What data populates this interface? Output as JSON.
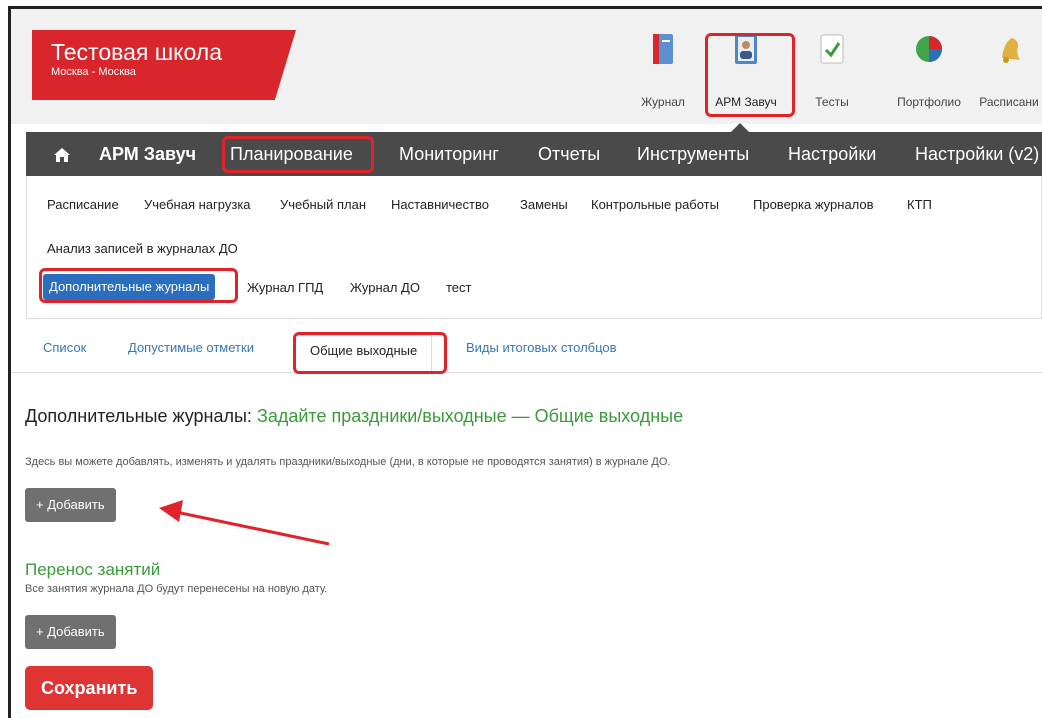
{
  "school": {
    "name": "Тестовая школа",
    "city": "Москва - Москва"
  },
  "apps": [
    {
      "label": "Журнал",
      "icon": "journal-icon"
    },
    {
      "label": "АРМ Завуч",
      "icon": "deputy-icon",
      "highlighted": true
    },
    {
      "label": "Тесты",
      "icon": "tests-icon"
    },
    {
      "label": "Портфолио",
      "icon": "portfolio-icon"
    },
    {
      "label": "Расписани",
      "icon": "bell-icon"
    }
  ],
  "topnav": {
    "home_icon": "home-icon",
    "items": [
      "АРМ Завуч",
      "Планирование",
      "Мониторинг",
      "Отчеты",
      "Инструменты",
      "Настройки",
      "Настройки (v2)"
    ],
    "highlighted": "Планирование"
  },
  "submenu": {
    "row1": [
      "Расписание",
      "Учебная нагрузка",
      "Учебный план",
      "Наставничество",
      "Замены",
      "Контрольные работы",
      "Проверка журналов",
      "КТП"
    ],
    "row2": [
      "Анализ записей в журналах ДО"
    ],
    "row3": [
      "Дополнительные журналы",
      "Журнал ГПД",
      "Журнал ДО",
      "тест"
    ],
    "active": "Дополнительные журналы"
  },
  "tabs": [
    "Список",
    "Допустимые отметки",
    "Общие выходные",
    "Виды итоговых столбцов"
  ],
  "active_tab": "Общие выходные",
  "content": {
    "heading_prefix": "Дополнительные журналы:",
    "heading_green": "Задайте праздники/выходные — Общие выходные",
    "description": "Здесь вы можете добавлять, изменять и удалять праздники/выходные (дни, в которые не проводятся занятия) в журнале ДО.",
    "add_button": "+ Добавить",
    "transfer_title": "Перенос занятий",
    "transfer_note": "Все занятия журнала ДО будут перенесены на новую дату.",
    "add_button_2": "+ Добавить",
    "save_button": "Сохранить"
  },
  "colors": {
    "brand_red": "#d8262c",
    "nav_dark": "#4a4a4a",
    "link_blue": "#3776b8",
    "green": "#3a9a3a",
    "highlight": "#e0232b"
  }
}
